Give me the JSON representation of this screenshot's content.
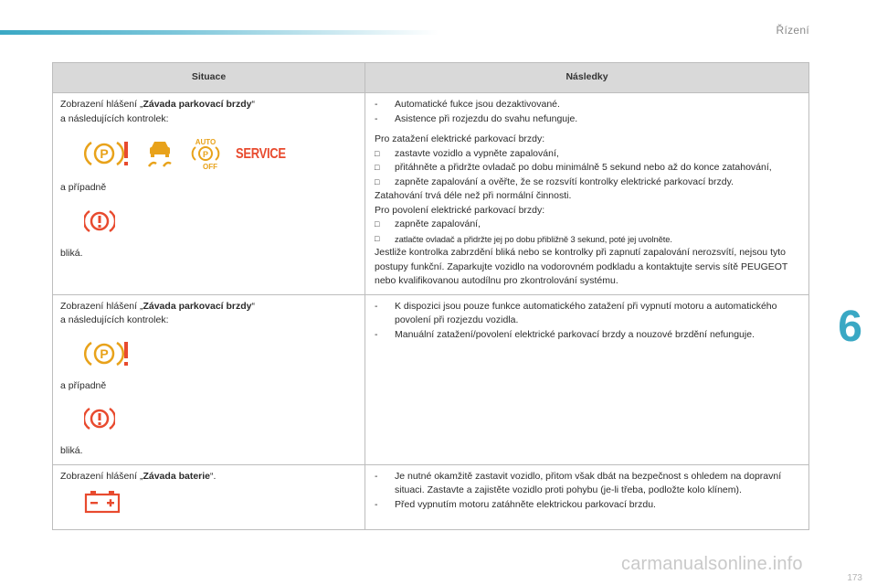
{
  "header": {
    "section_title": "Řízení",
    "chapter_number": "6",
    "page_number": "173"
  },
  "watermark": "carmanualsonline.info",
  "table": {
    "col_situation": "Situace",
    "col_consequences": "Následky",
    "rows": [
      {
        "s_prefix": "Zobrazení hlášení „",
        "s_bold": "Závada parkovací brzdy",
        "s_suffix": "“",
        "s_line2": "a následujících kontrolek:",
        "s_alt": "a případně",
        "s_blink": "bliká.",
        "icons": [
          "parking-brake-warning",
          "stability-control",
          "auto-parking-brake-off",
          "service-warning"
        ],
        "service_text": "SERVICE",
        "auto_text": "AUTO",
        "off_text": "OFF",
        "p_letter": "P",
        "c_dash1": "Automatické fukce jsou dezaktivované.",
        "c_dash2": "Asistence při rozjezdu do svahu nefunguje.",
        "c_intro": "Pro zatažení elektrické parkovací brzdy:",
        "c_b1": "zastavte vozidlo a vypněte zapalování,",
        "c_b2": "přitáhněte a přidržte ovladač po dobu minimálně 5 sekund nebo až do konce zatahování,",
        "c_b3": "zapněte zapalování a ověřte, že se rozsvítí kontrolky elektrické parkovací brzdy.",
        "c_p1": "Zatahování trvá déle než při normální činnosti.",
        "c_p2": "Pro povolení elektrické parkovací brzdy:",
        "c_b4": "zapněte zapalování,",
        "c_b5": "zatlačte ovladač a přidržte jej po dobu přibližně 3 sekund, poté jej uvolněte.",
        "c_p3": "Jestliže kontrolka zabrzdění bliká nebo se kontrolky při zapnutí zapalování nerozsvítí, nejsou tyto postupy funkční. Zaparkujte vozidlo na vodorovném podkladu a kontaktujte servis sítě PEUGEOT nebo kvalifikovanou autodílnu pro zkontrolování systému."
      },
      {
        "s_prefix": "Zobrazení hlášení „",
        "s_bold": "Závada parkovací brzdy",
        "s_suffix": "“",
        "s_line2": "a následujících kontrolek:",
        "s_alt": "a případně",
        "s_blink": "bliká.",
        "c_dash1": "K dispozici jsou pouze funkce automatického zatažení při vypnutí motoru a automatického povolení při rozjezdu vozidla.",
        "c_dash2": "Manuální zatažení/povolení elektrické parkovací brzdy a nouzové brzdění nefunguje."
      },
      {
        "s_prefix": "Zobrazení hlášení „",
        "s_bold": "Závada baterie",
        "s_suffix": "“.",
        "c_dash1": "Je nutné okamžitě zastavit vozidlo, přitom však dbát na bezpečnost s ohledem na dopravní situaci. Zastavte a zajistěte vozidlo proti pohybu (je-li třeba, podložte kolo klínem).",
        "c_dash2": "Před vypnutím motoru zatáhněte elektrickou parkovací brzdu."
      }
    ]
  },
  "colors": {
    "accent": "#3aa8c4",
    "warning_red": "#e84a2e",
    "caution_amber": "#e8a21a",
    "header_gray": "#d9d9d9"
  }
}
